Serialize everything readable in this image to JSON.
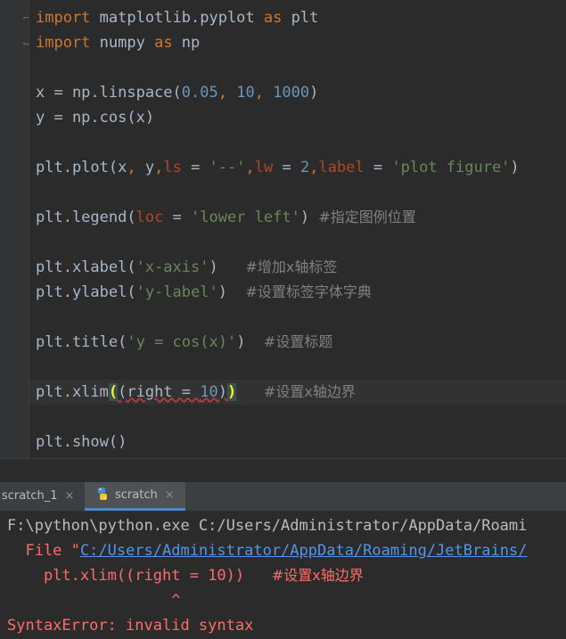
{
  "editor": {
    "l1": {
      "kw1": "import",
      "mod": " matplotlib.pyplot ",
      "kw2": "as",
      "alias": " plt"
    },
    "l2": {
      "kw1": "import",
      "mod": " numpy ",
      "kw2": "as",
      "alias": " np"
    },
    "l3": {
      "a": "x = np.linspace(",
      "n1": "0.05",
      "c1": ", ",
      "n2": "10",
      "c2": ", ",
      "n3": "1000",
      "b": ")"
    },
    "l4": {
      "a": "y = np.cos(x)"
    },
    "l5": {
      "a": "plt.plot(x",
      "c1": ",",
      "b": " y",
      "c2": ",",
      "p1": "ls",
      "e1": " = ",
      "s1": "'--'",
      "c3": ",",
      "p2": "lw",
      "e2": " = ",
      "n1": "2",
      "c4": ",",
      "p3": "label",
      "e3": " = ",
      "s2": "'plot figure'",
      "d": ")"
    },
    "l6": {
      "a": "plt.legend(",
      "p1": "loc",
      "e1": " = ",
      "s1": "'lower left'",
      "b": ") ",
      "cmt": "#指定图例位置"
    },
    "l7": {
      "a": "plt.xlabel(",
      "s1": "'x-axis'",
      "b": ")   ",
      "cmt": "#增加x轴标签"
    },
    "l8": {
      "a": "plt.ylabel(",
      "s1": "'y-label'",
      "b": ")  ",
      "cmt": "#设置标签字体字典"
    },
    "l9": {
      "a": "plt.title(",
      "s1": "'y = cos(x)'",
      "b": ")  ",
      "cmt": "#设置标题"
    },
    "l10": {
      "a": "plt.xlim",
      "o": "(",
      "w": "(right = ",
      "n1": "10",
      "c": ")",
      "cl": ")",
      "b": "   ",
      "cmt": "#设置x轴边界"
    },
    "l11": {
      "a": "plt.show()"
    }
  },
  "tabs": [
    {
      "label": "scratch_1",
      "close": "×"
    },
    {
      "label": "scratch",
      "close": "×"
    }
  ],
  "console": {
    "cmd": "F:\\python\\python.exe C:/Users/Administrator/AppData/Roami",
    "file_prefix": "  File \"",
    "file_link": "C:/Users/Administrator/AppData/Roaming/JetBrains/",
    "code_a": "    plt.xlim((right = 10))   ",
    "code_cmt": "#设置x轴边界",
    "caret": "                  ^",
    "error": "SyntaxError: invalid syntax"
  }
}
